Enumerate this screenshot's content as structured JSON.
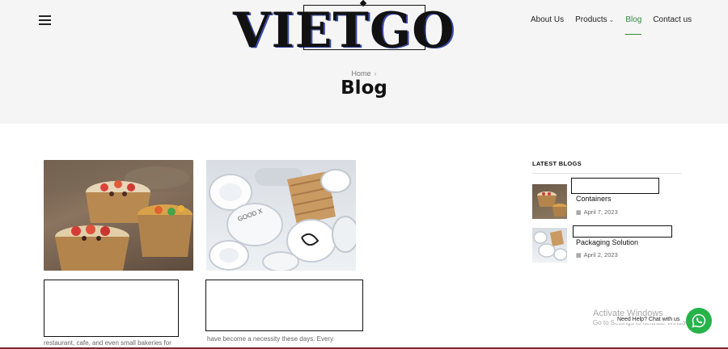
{
  "header": {
    "logo_text": "VIETGO",
    "nav": [
      {
        "label": "About Us",
        "active": false
      },
      {
        "label": "Products",
        "active": false,
        "has_dropdown": true
      },
      {
        "label": "Blog",
        "active": true
      },
      {
        "label": "Contact us",
        "active": false
      }
    ]
  },
  "hero": {
    "breadcrumb_home": "Home",
    "title": "Blog"
  },
  "posts": [
    {
      "excerpt": "restaurant, cafe, and even small bakeries for"
    },
    {
      "excerpt": "have become a necessity these days. Every"
    }
  ],
  "sidebar": {
    "heading": "LATEST BLOGS",
    "items": [
      {
        "title": "Containers",
        "date": "April 7, 2023"
      },
      {
        "title": "Packaging Solution",
        "date": "April 2, 2023"
      }
    ]
  },
  "overlay": {
    "watermark_title": "Activate Windows",
    "watermark_sub": "Go to Settings to activate Windows.",
    "chat_label": "Need Help? Chat with us"
  },
  "colors": {
    "accent_green": "#2f8a3a",
    "whatsapp_green": "#25b34a",
    "hero_bg": "#f5f5f5"
  },
  "icons": {
    "menu": "hamburger-icon",
    "chevron": "chevron-down-icon",
    "calendar": "calendar-icon",
    "chat": "whatsapp-icon"
  }
}
